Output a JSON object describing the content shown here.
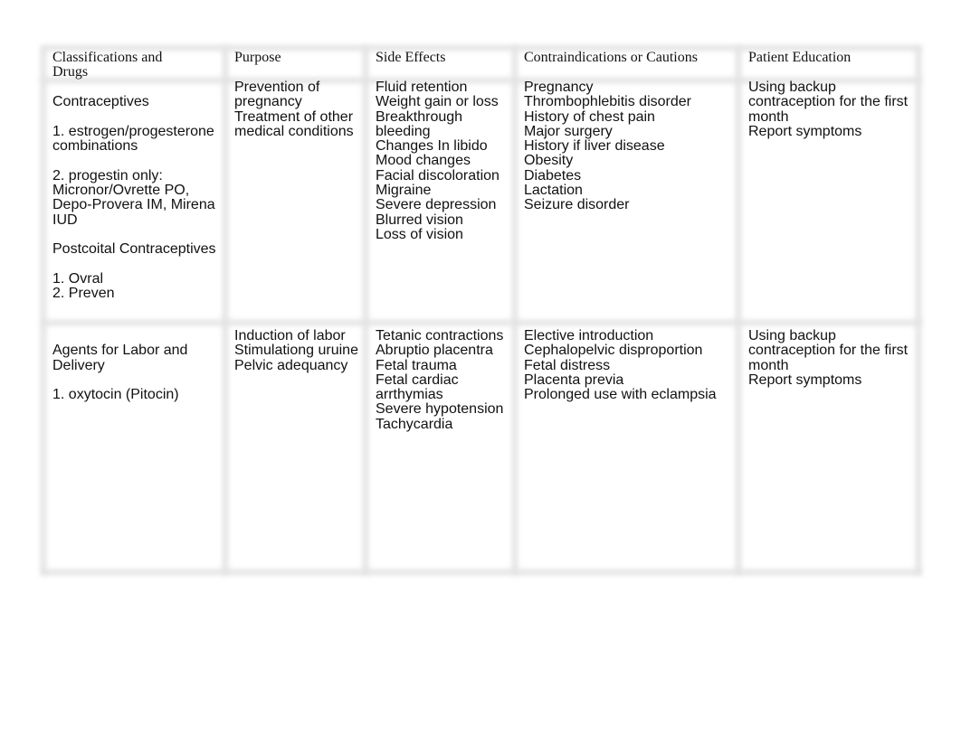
{
  "table": {
    "headers": [
      [
        "Classifications and",
        "Drugs"
      ],
      [
        "Purpose"
      ],
      [
        "Side Effects"
      ],
      [
        "Contraindications or Cautions"
      ],
      [
        "Patient Education"
      ]
    ],
    "rows": [
      [
        [
          "",
          "Contraceptives",
          "",
          "1. estrogen/progesterone",
          "combinations",
          "",
          "2. progestin only:",
          "Micronor/Ovrette PO,",
          "Depo-Provera IM, Mirena",
          "IUD",
          "",
          "Postcoital Contraceptives",
          "",
          "1. Ovral",
          "2. Preven"
        ],
        [
          "Prevention of",
          "pregnancy",
          "Treatment of other",
          "medical conditions"
        ],
        [
          "Fluid retention",
          "Weight gain or loss",
          "Breakthrough",
          "bleeding",
          "Changes In libido",
          "Mood changes",
          "Facial discoloration",
          "Migraine",
          "Severe depression",
          "Blurred vision",
          "Loss of vision"
        ],
        [
          "Pregnancy",
          "Thrombophlebitis disorder",
          "History of chest pain",
          "Major surgery",
          "History if liver disease",
          "Obesity",
          "Diabetes",
          "Lactation",
          "Seizure disorder"
        ],
        [
          "Using backup",
          "contraception for the first",
          "month",
          "Report symptoms"
        ]
      ],
      [
        [
          "",
          "Agents for Labor and",
          "Delivery",
          "",
          "1. oxytocin (Pitocin)"
        ],
        [
          "Induction of labor",
          "Stimulationg uruine",
          "Pelvic adequancy"
        ],
        [
          "Tetanic contractions",
          "Abruptio placentra",
          "Fetal trauma",
          "Fetal cardiac",
          "arrthymias",
          "Severe hypotension",
          "Tachycardia"
        ],
        [
          "Elective introduction",
          "Cephalopelvic disproportion",
          "Fetal distress",
          "Placenta previa",
          "Prolonged use with eclampsia"
        ],
        [
          "Using backup",
          "contraception for the first",
          "month",
          "Report symptoms"
        ]
      ]
    ]
  }
}
